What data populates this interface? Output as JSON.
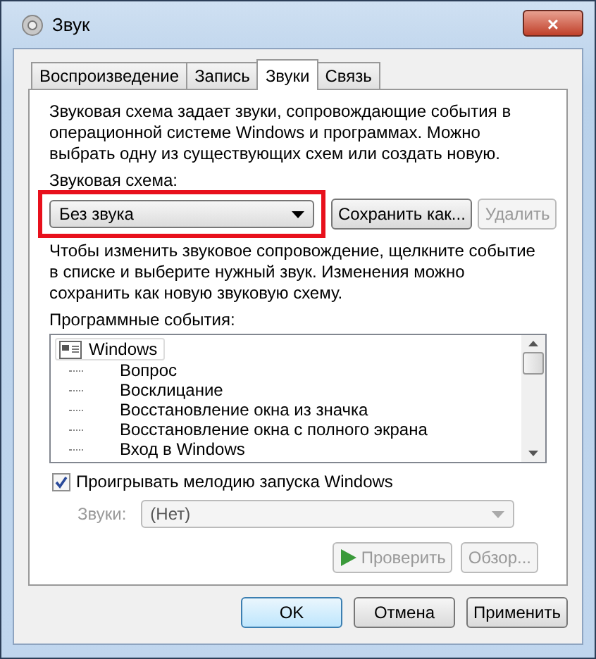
{
  "window": {
    "title": "Звук",
    "close": "×"
  },
  "tabs": [
    {
      "label": "Воспроизведение",
      "selected": false
    },
    {
      "label": "Запись",
      "selected": false
    },
    {
      "label": "Звуки",
      "selected": true
    },
    {
      "label": "Связь",
      "selected": false
    }
  ],
  "description": "Звуковая схема задает звуки, сопровождающие события в операционной системе Windows и программах. Можно выбрать одну из существующих схем или создать новую.",
  "scheme": {
    "label": "Звуковая схема:",
    "value": "Без звука",
    "highlighted": true
  },
  "scheme_buttons": [
    {
      "label": "Сохранить как...",
      "disabled": false
    },
    {
      "label": "Удалить",
      "disabled": true
    }
  ],
  "hint": "Чтобы изменить звуковое сопровождение, щелкните событие в списке и выберите нужный звук. Изменения можно сохранить как новую звуковую схему.",
  "events": {
    "label": "Программные события:",
    "items": [
      {
        "label": "Windows",
        "selected": false,
        "children": [
          {
            "label": "Вопрос"
          },
          {
            "label": "Восклицание"
          },
          {
            "label": "Восстановление окна из значка"
          },
          {
            "label": "Восстановление окна с полного экрана"
          },
          {
            "label": "Вход в Windows"
          }
        ]
      }
    ]
  },
  "startup_sound": {
    "label": "Проигрывать мелодию запуска Windows",
    "checked": true
  },
  "sounds": {
    "label": "Звуки:",
    "value": "(Нет)",
    "disabled": true
  },
  "sound_buttons": [
    {
      "label": "Проверить",
      "kind": "play",
      "disabled": true
    },
    {
      "label": "Обзор...",
      "kind": "plain",
      "disabled": true
    }
  ],
  "buttons": [
    {
      "label": "OK",
      "default": true
    },
    {
      "label": "Отмена",
      "default": false
    },
    {
      "label": "Применить",
      "default": false
    }
  ]
}
